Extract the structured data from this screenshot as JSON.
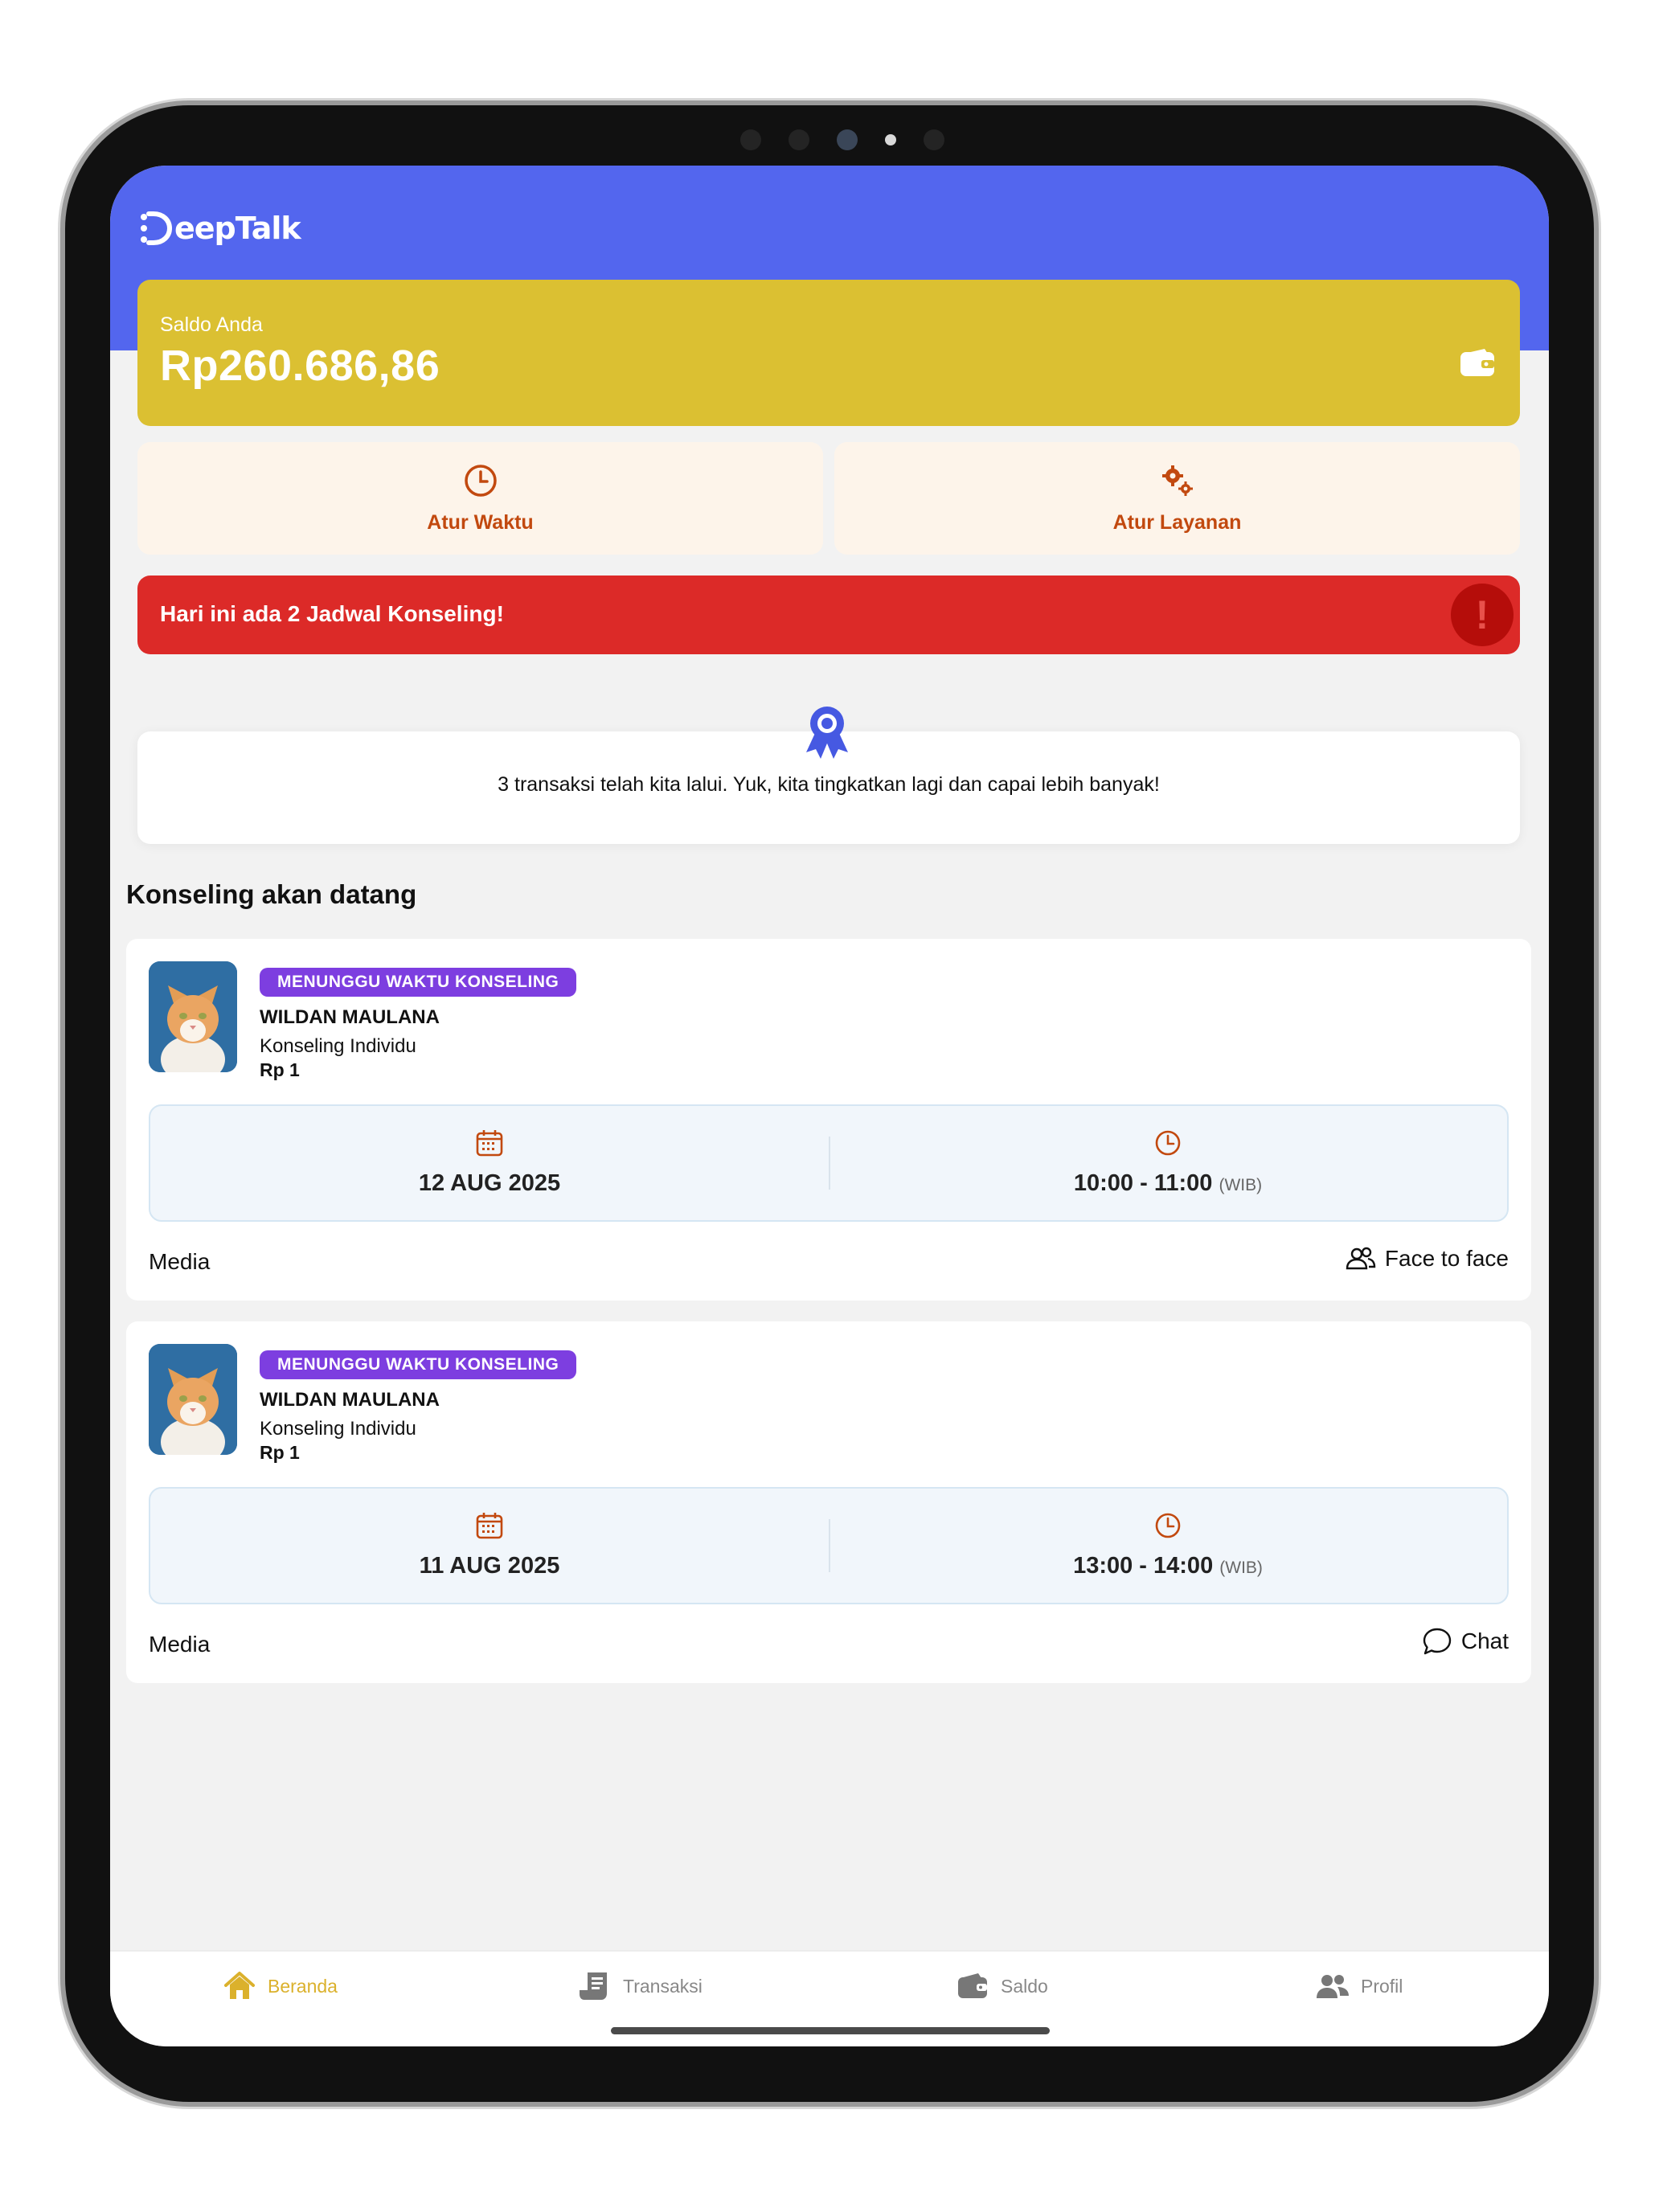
{
  "app": {
    "logo_text": "eepTalk",
    "brand_color": "#5366ee"
  },
  "balance": {
    "label": "Saldo Anda",
    "amount": "Rp260.686,86",
    "icon": "wallet-icon"
  },
  "actions": [
    {
      "label": "Atur Waktu",
      "icon": "clock-icon"
    },
    {
      "label": "Atur Layanan",
      "icon": "gears-icon"
    }
  ],
  "alert": {
    "text": "Hari ini ada 2 Jadwal Konseling!",
    "icon_text": "!"
  },
  "promo": {
    "text": "3 transaksi telah kita lalui. Yuk, kita tingkatkan lagi dan capai lebih banyak!",
    "icon": "award-badge-icon"
  },
  "section": {
    "title": "Konseling akan datang"
  },
  "sessions": [
    {
      "status": "MENUNGGU WAKTU KONSELING",
      "name": "WILDAN MAULANA",
      "type": "Konseling Individu",
      "price": "Rp 1",
      "date": "12 AUG 2025",
      "time": "10:00 - 11:00",
      "timezone": "(WIB)",
      "media_label": "Media",
      "media_value": "Face to face",
      "media_icon": "people-icon"
    },
    {
      "status": "MENUNGGU WAKTU KONSELING",
      "name": "WILDAN MAULANA",
      "type": "Konseling Individu",
      "price": "Rp 1",
      "date": "11 AUG 2025",
      "time": "13:00 - 14:00",
      "timezone": "(WIB)",
      "media_label": "Media",
      "media_value": "Chat",
      "media_icon": "chat-bubble-icon"
    }
  ],
  "tabs": [
    {
      "label": "Beranda",
      "icon": "home-icon",
      "active": true
    },
    {
      "label": "Transaksi",
      "icon": "receipt-icon",
      "active": false
    },
    {
      "label": "Saldo",
      "icon": "wallet-icon",
      "active": false
    },
    {
      "label": "Profil",
      "icon": "users-icon",
      "active": false
    }
  ],
  "colors": {
    "balance": "#dbc032",
    "alert": "#dc2a28",
    "status_badge": "#7d3ee0",
    "accent_orange": "#c2490f",
    "tab_active": "#dbb12c"
  }
}
